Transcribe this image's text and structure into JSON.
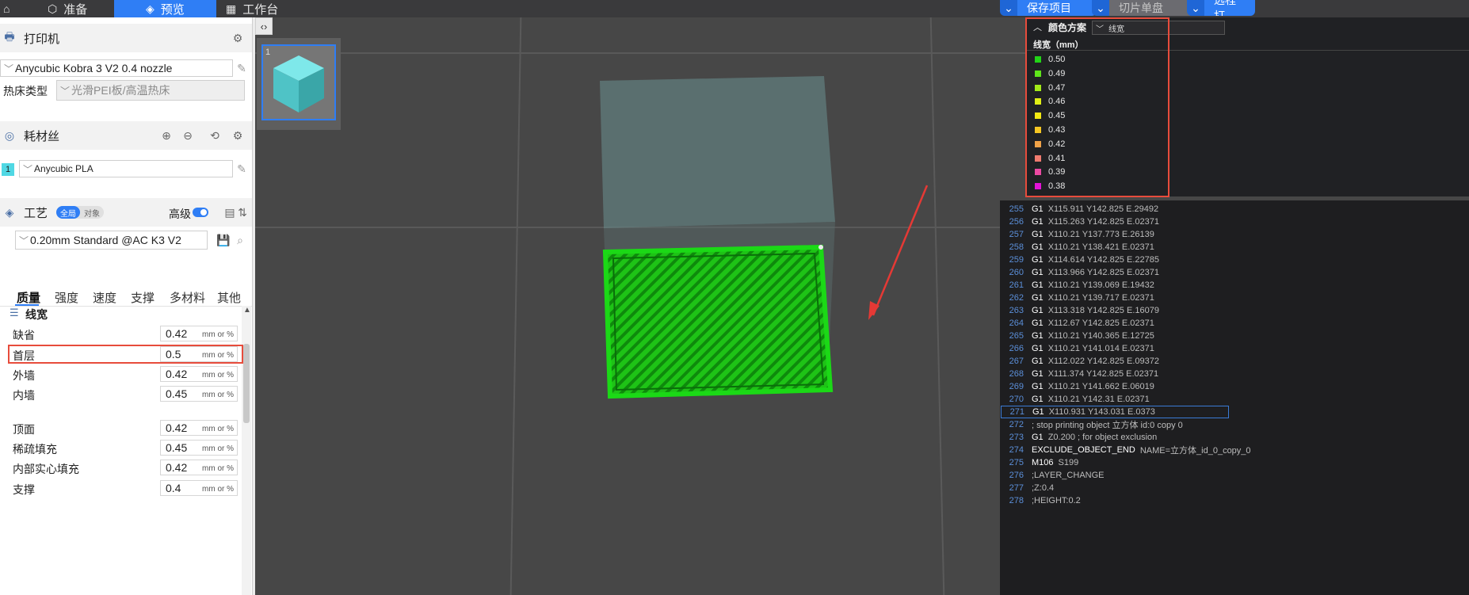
{
  "topbar": {
    "tabs": [
      {
        "label": "准备"
      },
      {
        "label": "预览"
      },
      {
        "label": "工作台"
      }
    ],
    "save_project": "保存项目",
    "slice_plate": "切片单盘",
    "remote": "远程打"
  },
  "printer": {
    "section_title": "打印机",
    "printer_name": "Anycubic Kobra 3 V2 0.4 nozzle",
    "bed_type_label": "热床类型",
    "bed_type_value": "光滑PEI板/高温热床"
  },
  "filament": {
    "section_title": "耗材丝",
    "slot": "1",
    "name": "Anycubic PLA"
  },
  "process": {
    "section_title": "工艺",
    "toggle_global": "全局",
    "toggle_object": "对象",
    "advanced_label": "高级",
    "profile": "0.20mm Standard @AC K3 V2",
    "tabs": [
      "质量",
      "强度",
      "速度",
      "支撑",
      "多材料",
      "其他"
    ],
    "group_title": "线宽",
    "unit": "mm or %",
    "rows": [
      {
        "label": "缺省",
        "value": "0.42"
      },
      {
        "label": "首层",
        "value": "0.5"
      },
      {
        "label": "外墙",
        "value": "0.42"
      },
      {
        "label": "内墙",
        "value": "0.45"
      },
      {
        "label": "顶面",
        "value": "0.42"
      },
      {
        "label": "稀疏填充",
        "value": "0.45"
      },
      {
        "label": "内部实心填充",
        "value": "0.42"
      },
      {
        "label": "支撑",
        "value": "0.4"
      }
    ]
  },
  "viewport": {
    "thumbnail_index": "1"
  },
  "legend": {
    "title": "颜色方案",
    "scheme": "线宽",
    "unit_header": "线宽（mm）",
    "colors": {
      "c050": "#22d417",
      "c049": "#5ee41a",
      "c047": "#a3ea18",
      "c046": "#e0ee16",
      "c045": "#f2e813",
      "c043": "#f5c623",
      "c042": "#f0a248",
      "c041": "#ef7b6f",
      "c039": "#ec4aa3",
      "c038": "#e413d8"
    },
    "items": [
      {
        "value": "0.50",
        "color": "#22d417"
      },
      {
        "value": "0.49",
        "color": "#5ee41a"
      },
      {
        "value": "0.47",
        "color": "#a3ea18"
      },
      {
        "value": "0.46",
        "color": "#e0ee16"
      },
      {
        "value": "0.45",
        "color": "#f2e813"
      },
      {
        "value": "0.43",
        "color": "#f5c623"
      },
      {
        "value": "0.42",
        "color": "#f0a248"
      },
      {
        "value": "0.41",
        "color": "#ef7b6f"
      },
      {
        "value": "0.39",
        "color": "#ec4aa3"
      },
      {
        "value": "0.38",
        "color": "#e413d8"
      }
    ]
  },
  "gcode": {
    "lines": [
      {
        "num": "255",
        "cmd": "G1",
        "args": "X115.911 Y142.825 E.29492"
      },
      {
        "num": "256",
        "cmd": "G1",
        "args": "X115.263 Y142.825 E.02371"
      },
      {
        "num": "257",
        "cmd": "G1",
        "args": "X110.21 Y137.773 E.26139"
      },
      {
        "num": "258",
        "cmd": "G1",
        "args": "X110.21 Y138.421 E.02371"
      },
      {
        "num": "259",
        "cmd": "G1",
        "args": "X114.614 Y142.825 E.22785"
      },
      {
        "num": "260",
        "cmd": "G1",
        "args": "X113.966 Y142.825 E.02371"
      },
      {
        "num": "261",
        "cmd": "G1",
        "args": "X110.21 Y139.069 E.19432"
      },
      {
        "num": "262",
        "cmd": "G1",
        "args": "X110.21 Y139.717 E.02371"
      },
      {
        "num": "263",
        "cmd": "G1",
        "args": "X113.318 Y142.825 E.16079"
      },
      {
        "num": "264",
        "cmd": "G1",
        "args": "X112.67 Y142.825 E.02371"
      },
      {
        "num": "265",
        "cmd": "G1",
        "args": "X110.21 Y140.365 E.12725"
      },
      {
        "num": "266",
        "cmd": "G1",
        "args": "X110.21 Y141.014 E.02371"
      },
      {
        "num": "267",
        "cmd": "G1",
        "args": "X112.022 Y142.825 E.09372"
      },
      {
        "num": "268",
        "cmd": "G1",
        "args": "X111.374 Y142.825 E.02371"
      },
      {
        "num": "269",
        "cmd": "G1",
        "args": "X110.21 Y141.662 E.06019"
      },
      {
        "num": "270",
        "cmd": "G1",
        "args": "X110.21 Y142.31 E.02371"
      },
      {
        "num": "271",
        "cmd": "G1",
        "args": "X110.931 Y143.031 E.0373"
      },
      {
        "num": "272",
        "cmd": "",
        "args": "; stop printing object 立方体 id:0 copy 0"
      },
      {
        "num": "273",
        "cmd": "G1",
        "args": "Z0.200 ; for object exclusion"
      },
      {
        "num": "274",
        "cmd": "EXCLUDE_OBJECT_END",
        "args": "NAME=立方体_id_0_copy_0"
      },
      {
        "num": "275",
        "cmd": "M106",
        "args": "S199"
      },
      {
        "num": "276",
        "cmd": "",
        "args": ";LAYER_CHANGE"
      },
      {
        "num": "277",
        "cmd": "",
        "args": ";Z:0.4"
      },
      {
        "num": "278",
        "cmd": "",
        "args": ";HEIGHT:0.2"
      }
    ]
  }
}
